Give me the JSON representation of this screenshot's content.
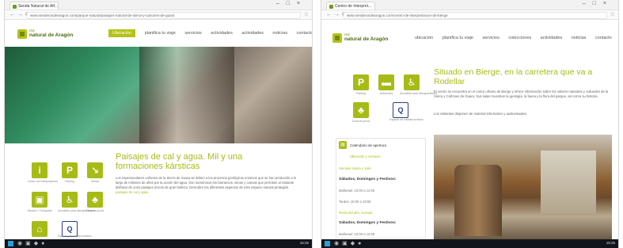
{
  "left": {
    "tab_title": "Senda Natural de Alf...",
    "url": "www.senderosdearagon.com/parque-natural/paisajes-natural-de-sierra-y-canones-de-guara",
    "logo": {
      "line1": "red",
      "line2": "natural de Aragón"
    },
    "menu": [
      "Ubicación",
      "planifica tu viaje",
      "servicios",
      "actividades",
      "actividades",
      "noticias",
      "contacto"
    ],
    "headline": "Paisajes de cal y agua. Mil y una formaciones kársticas",
    "paragraph": "Los espectaculares cañones de la Sierra de Guara se deben a los procesos geológicos erosivos que se han producido a lo largo de millones de años por la acción del agua. Son numerosos los barrancos, simas y cuevas que permiten al visitante disfrutar de unos paisajes únicos de gran belleza. Descubre los diferentes aspectos de este espacio natural protegido.",
    "paragraph_highlight": "paisajes de cal y agua",
    "icons": [
      {
        "glyph": "i",
        "caption": "Centro de Interpretación",
        "icon": "info-icon"
      },
      {
        "glyph": "P",
        "caption": "Parking",
        "icon": "parking-icon"
      },
      {
        "glyph": "↘",
        "caption": "Senda",
        "icon": "hiking-icon"
      },
      {
        "glyph": "▣",
        "caption": "Mirador / Fotografía",
        "icon": "camera-icon"
      },
      {
        "glyph": "♿",
        "caption": "Accesible para discapacitados",
        "icon": "wheelchair-icon"
      },
      {
        "glyph": "♣",
        "caption": "Zona de picnic",
        "icon": "picnic-icon"
      },
      {
        "glyph": "⌂",
        "caption": "Punto de información",
        "icon": "house-icon"
      },
      {
        "glyph": "Q",
        "caption": "Espacio de calidad turística",
        "icon": "quality-q-icon"
      }
    ],
    "taskbar_time": "16:25"
  },
  "right": {
    "tab_title": "Centro de Interpret...",
    "url": "www.senderosdearagon.com/centro-de-interpretacion-de-bierge",
    "logo": {
      "line1": "red",
      "line2": "natural de Aragón"
    },
    "menu": [
      "ubicación",
      "planifica tu viaje",
      "servicios",
      "colecciones",
      "actividades",
      "noticias",
      "contacto"
    ],
    "headline": "Situado en Bierge, en la carretera que va a Rodellar",
    "paragraph": "El centro se encuentra en el casco urbano de Bierge y ofrece información sobre los valores naturales y culturales de la Sierra y Cañones de Guara. Sus salas muestran la geología, la fauna y la flora del parque, así como su historia.",
    "paragraph2": "Los visitantes disponen de material informativo y audiovisuales.",
    "icons": [
      {
        "glyph": "P",
        "caption": "Parking",
        "icon": "parking-icon"
      },
      {
        "glyph": "▬",
        "caption": "Autobuses",
        "icon": "bus-icon"
      },
      {
        "glyph": "♿",
        "caption": "Accesible para discapacitados",
        "icon": "wheelchair-icon"
      },
      {
        "glyph": "♣",
        "caption": "Zona de picnic",
        "icon": "picnic-icon"
      },
      {
        "glyph": "Q",
        "caption": "Espacio de calidad turística",
        "icon": "quality-q-icon"
      }
    ],
    "sidebar": {
      "title": "Calendario de apertura",
      "link1": "Ubicación y contacto",
      "link2": "Semana Santa y Julio",
      "bold1": "Sábados, Domingos y Festivos:",
      "text1": "Mañanas: 10:00 a 14:00",
      "text2": "Tardes: 16:00 a 19:00",
      "link3": "Resto del año, cerrado",
      "bold2": "Sábados, Domingos y Festivos:",
      "text3": "Mañanas: 10:00 a 14:00"
    },
    "taskbar_time": "16:25"
  }
}
